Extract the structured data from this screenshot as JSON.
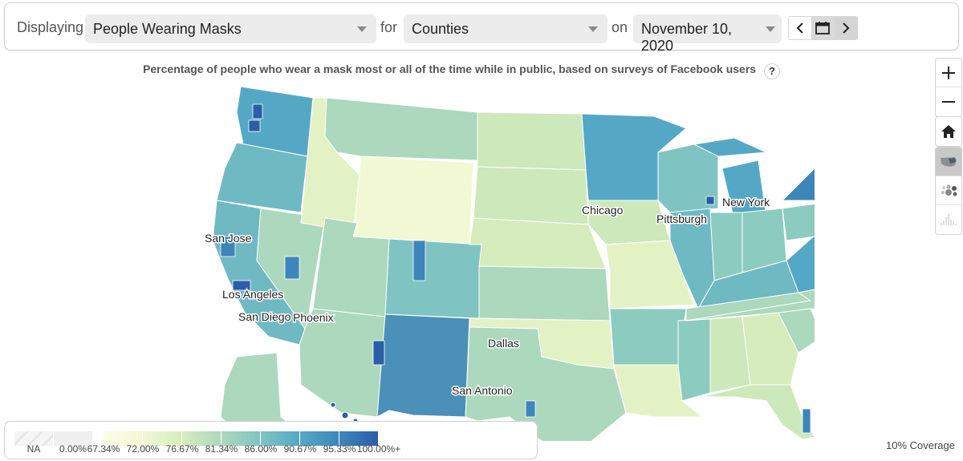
{
  "toolbar": {
    "displaying_label": "Displaying",
    "indicator_value": "People Wearing Masks",
    "for_label": "for",
    "geo_value": "Counties",
    "on_label": "on",
    "date_value": "November 10, 2020",
    "prev_icon": "chevron-left-icon",
    "calendar_icon": "calendar-icon",
    "next_icon": "chevron-right-icon"
  },
  "subtitle": {
    "text": "Percentage of people who wear a mask most or all of the time while in public, based on surveys of Facebook users",
    "help": "?"
  },
  "controls": {
    "zoom_in": "+",
    "zoom_out": "−",
    "home_icon": "home-icon",
    "views": [
      "choropleth-map-view",
      "bubble-map-view",
      "spike-map-view"
    ],
    "active_view": "choropleth-map-view"
  },
  "map": {
    "cities": [
      {
        "name": "Chicago"
      },
      {
        "name": "Pittsburgh"
      },
      {
        "name": "New York"
      },
      {
        "name": "San Jose"
      },
      {
        "name": "Los Angeles"
      },
      {
        "name": "San Diego"
      },
      {
        "name": "Phoenix"
      },
      {
        "name": "Dallas"
      },
      {
        "name": "San Antonio"
      }
    ]
  },
  "legend": {
    "na_label": "NA",
    "zero_label": "0.00%",
    "breaks": [
      "67.34%",
      "72.00%",
      "76.67%",
      "81.34%",
      "86.00%",
      "90.67%",
      "95.33%",
      "100.00%+"
    ],
    "colors": [
      "#f3f8d4",
      "#d6ecbd",
      "#acd8bd",
      "#7fc4c2",
      "#55a8c5",
      "#3d86ba",
      "#2b5ea8"
    ],
    "na_color": "#eeeeee",
    "zero_color": "#f0f0f0"
  },
  "coverage": "10% Coverage"
}
